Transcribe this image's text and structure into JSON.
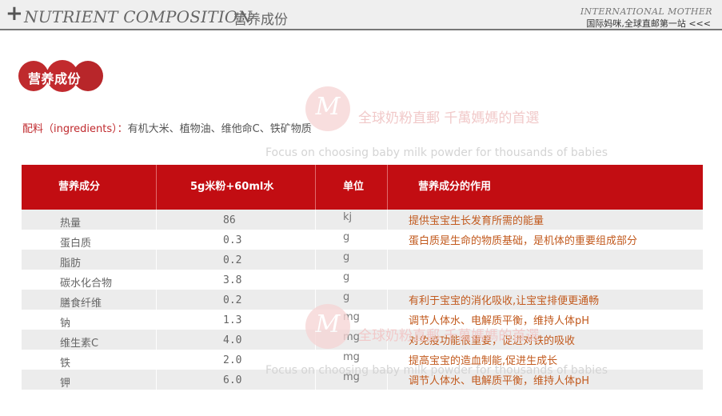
{
  "header": {
    "plus": "+",
    "title_en": "NUTRIENT COMPOSITION",
    "title_cn": "营养成份",
    "brand": "INTERNATIONAL MOTHER",
    "slogan": "国际妈咪,全球直邮第一站 <<<"
  },
  "badge": {
    "label": "营养成份"
  },
  "ingredients": {
    "label": "配料（ingredients）：",
    "value": "有机大米、植物油、维他命C、铁矿物质"
  },
  "watermark": {
    "logo_letter": "M",
    "cn_text": "全球奶粉直郵 千萬媽媽的首選",
    "en_text": "Focus on choosing baby milk powder for thousands of babies"
  },
  "table": {
    "headers": [
      "营养成分",
      "5g米粉+60ml水",
      "单位",
      "营养成分的作用"
    ],
    "rows": [
      {
        "name": "热量",
        "amount": "86",
        "unit": "kj",
        "effect": "提供宝宝生长发育所需的能量"
      },
      {
        "name": "蛋白质",
        "amount": "0.3",
        "unit": "g",
        "effect": "蛋白质是生命的物质基础，是机体的重要组成部分"
      },
      {
        "name": "脂肪",
        "amount": "0.2",
        "unit": "g",
        "effect": ""
      },
      {
        "name": "碳水化合物",
        "amount": "3.8",
        "unit": "g",
        "effect": ""
      },
      {
        "name": "膳食纤维",
        "amount": "0.2",
        "unit": "g",
        "effect": "有利于宝宝的消化吸收,让宝宝排便更通畅"
      },
      {
        "name": "钠",
        "amount": "1.3",
        "unit": "mg",
        "effect": "调节人体水、电解质平衡，维持人体pH"
      },
      {
        "name": "维生素C",
        "amount": "4.0",
        "unit": "mg",
        "effect": "对免疫功能很重要，促进对铁的吸收"
      },
      {
        "name": "铁",
        "amount": "2.0",
        "unit": "mg",
        "effect": "提高宝宝的造血制能,促进生成长"
      },
      {
        "name": "钾",
        "amount": "6.0",
        "unit": "mg",
        "effect": "调节人体水、电解质平衡，维持人体pH"
      }
    ]
  },
  "colors": {
    "accent_red": "#c20d12",
    "effect_text": "#c25a1e",
    "row_stripe": "#ececec"
  }
}
